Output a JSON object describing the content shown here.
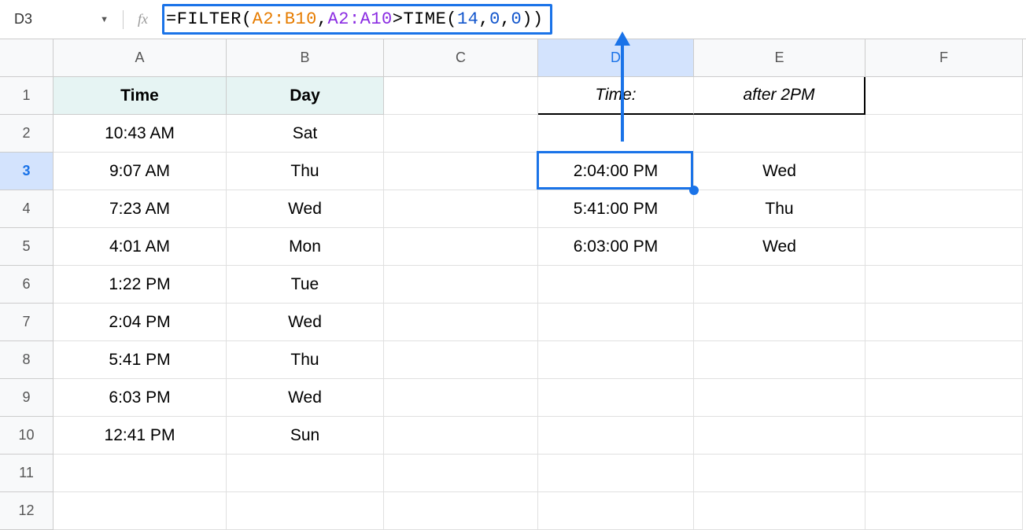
{
  "nameBox": "D3",
  "formula": {
    "parts": [
      {
        "t": "=FILTER(",
        "c": "tok-black"
      },
      {
        "t": "A2:B10",
        "c": "tok-orange"
      },
      {
        "t": ",",
        "c": "tok-black"
      },
      {
        "t": "A2:A10",
        "c": "tok-purple"
      },
      {
        "t": ">TIME(",
        "c": "tok-black"
      },
      {
        "t": "14",
        "c": "tok-blue"
      },
      {
        "t": ",",
        "c": "tok-black"
      },
      {
        "t": "0",
        "c": "tok-blue"
      },
      {
        "t": ",",
        "c": "tok-black"
      },
      {
        "t": "0",
        "c": "tok-blue"
      },
      {
        "t": "))",
        "c": "tok-black"
      }
    ]
  },
  "columns": [
    "A",
    "B",
    "C",
    "D",
    "E",
    "F"
  ],
  "rowNumbers": [
    "1",
    "2",
    "3",
    "4",
    "5",
    "6",
    "7",
    "8",
    "9",
    "10",
    "11",
    "12"
  ],
  "selectedRow": 3,
  "selectedCol": "D",
  "headers": {
    "A": "Time",
    "B": "Day"
  },
  "dHeader": "Time:",
  "eHeader": "after 2PM",
  "tableAB": [
    {
      "time": "10:43 AM",
      "day": "Sat"
    },
    {
      "time": "9:07 AM",
      "day": "Thu"
    },
    {
      "time": "7:23 AM",
      "day": "Wed"
    },
    {
      "time": "4:01 AM",
      "day": "Mon"
    },
    {
      "time": "1:22 PM",
      "day": "Tue"
    },
    {
      "time": "2:04 PM",
      "day": "Wed"
    },
    {
      "time": "5:41 PM",
      "day": "Thu"
    },
    {
      "time": "6:03 PM",
      "day": "Wed"
    },
    {
      "time": "12:41 PM",
      "day": "Sun"
    }
  ],
  "resultDE": [
    {
      "row": 3,
      "d": "2:04:00 PM",
      "e": "Wed"
    },
    {
      "row": 4,
      "d": "5:41:00 PM",
      "e": "Thu"
    },
    {
      "row": 5,
      "d": "6:03:00 PM",
      "e": "Wed"
    }
  ]
}
